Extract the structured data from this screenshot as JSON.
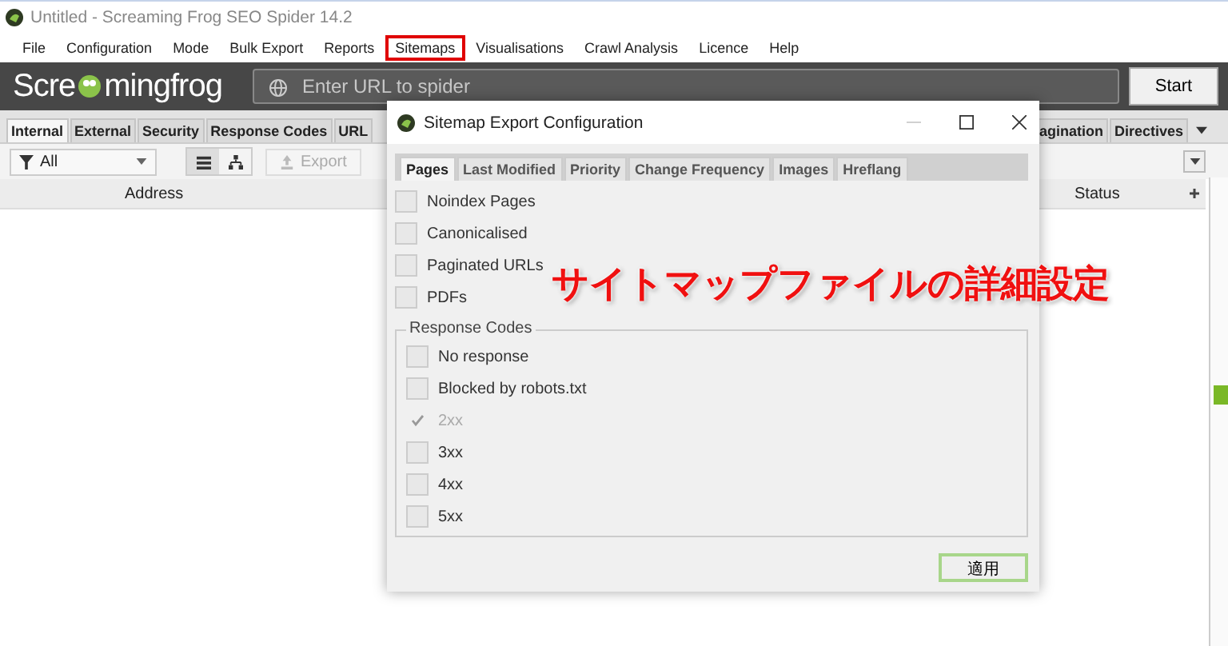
{
  "window": {
    "title": "Untitled - Screaming Frog SEO Spider 14.2"
  },
  "menu": [
    {
      "label": "File",
      "highlighted": false
    },
    {
      "label": "Configuration",
      "highlighted": false
    },
    {
      "label": "Mode",
      "highlighted": false
    },
    {
      "label": "Bulk Export",
      "highlighted": false
    },
    {
      "label": "Reports",
      "highlighted": false
    },
    {
      "label": "Sitemaps",
      "highlighted": true
    },
    {
      "label": "Visualisations",
      "highlighted": false
    },
    {
      "label": "Crawl Analysis",
      "highlighted": false
    },
    {
      "label": "Licence",
      "highlighted": false
    },
    {
      "label": "Help",
      "highlighted": false
    }
  ],
  "header_bar": {
    "logo_start": "Scre",
    "logo_middle": "mingfrog",
    "url_field": {
      "placeholder": "Enter URL to spider"
    },
    "start_button": "Start"
  },
  "tabs": [
    {
      "label": "Internal",
      "selected": true
    },
    {
      "label": "External",
      "selected": false
    },
    {
      "label": "Security",
      "selected": false
    },
    {
      "label": "Response Codes",
      "selected": false
    },
    {
      "label": "URL",
      "selected": false
    }
  ],
  "tabs_right": [
    {
      "label": "agination",
      "selected": false
    },
    {
      "label": "Directives",
      "selected": false
    }
  ],
  "toolbar": {
    "filter": "All",
    "export": "Export"
  },
  "table": {
    "columns": [
      "Address",
      "Status"
    ]
  },
  "dialog": {
    "title": "Sitemap Export Configuration",
    "tabs": [
      {
        "label": "Pages",
        "selected": true
      },
      {
        "label": "Last Modified",
        "selected": false
      },
      {
        "label": "Priority",
        "selected": false
      },
      {
        "label": "Change Frequency",
        "selected": false
      },
      {
        "label": "Images",
        "selected": false
      },
      {
        "label": "Hreflang",
        "selected": false
      }
    ],
    "options": [
      {
        "label": "Noindex Pages",
        "checked": false,
        "disabled": false
      },
      {
        "label": "Canonicalised",
        "checked": false,
        "disabled": false
      },
      {
        "label": "Paginated URLs",
        "checked": false,
        "disabled": false
      },
      {
        "label": "PDFs",
        "checked": false,
        "disabled": false
      }
    ],
    "response_codes": {
      "legend": "Response Codes",
      "options": [
        {
          "label": "No response",
          "checked": false,
          "disabled": false
        },
        {
          "label": "Blocked by robots.txt",
          "checked": false,
          "disabled": false
        },
        {
          "label": "2xx",
          "checked": true,
          "disabled": true
        },
        {
          "label": "3xx",
          "checked": false,
          "disabled": false
        },
        {
          "label": "4xx",
          "checked": false,
          "disabled": false
        },
        {
          "label": "5xx",
          "checked": false,
          "disabled": false
        }
      ]
    },
    "apply_button": "適用"
  },
  "annotation": "サイトマップファイルの詳細設定"
}
